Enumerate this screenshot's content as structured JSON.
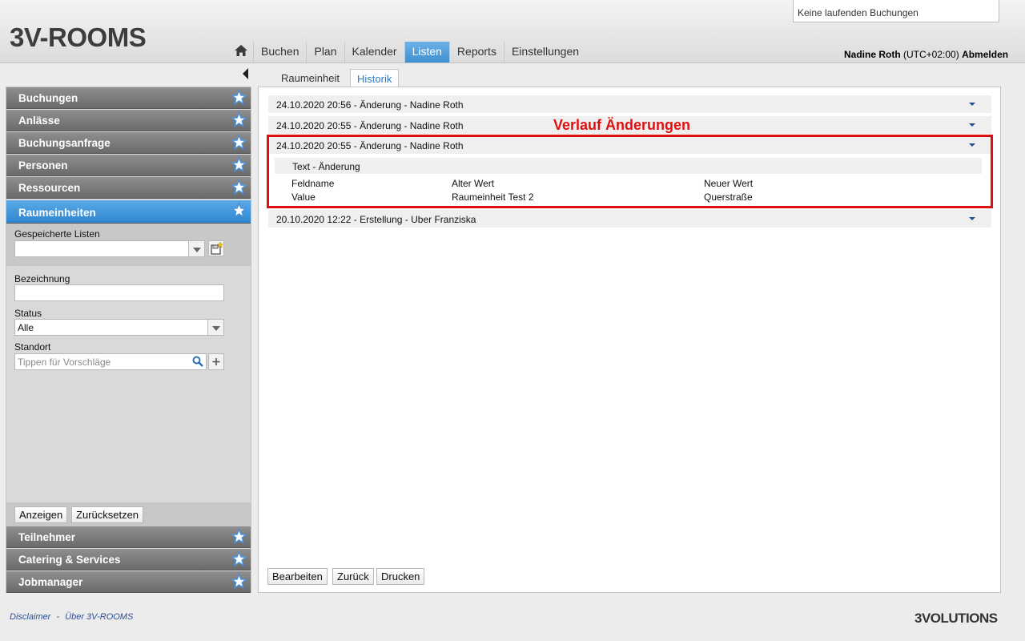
{
  "app": {
    "logo": "3V-ROOMS",
    "booking_status": "Keine laufenden Buchungen",
    "footer_logo": "3VOLUTIONS"
  },
  "nav": {
    "home_icon": "home-icon",
    "items": [
      "Buchen",
      "Plan",
      "Kalender",
      "Listen",
      "Reports",
      "Einstellungen"
    ],
    "active": "Listen"
  },
  "user": {
    "name": "Nadine Roth",
    "timezone": "(UTC+02:00)",
    "logout": "Abmelden"
  },
  "sidebar": {
    "sections_top": [
      "Buchungen",
      "Anlässe",
      "Buchungsanfrage",
      "Personen",
      "Ressourcen",
      "Raumeinheiten"
    ],
    "active_section": "Raumeinheiten",
    "sections_bottom": [
      "Teilnehmer",
      "Catering & Services",
      "Jobmanager"
    ],
    "saved_lists_label": "Gespeicherte Listen",
    "saved_lists_value": "",
    "filters": {
      "bezeichnung_label": "Bezeichnung",
      "bezeichnung_value": "",
      "status_label": "Status",
      "status_value": "Alle",
      "standort_label": "Standort",
      "standort_placeholder": "Tippen für Vorschläge"
    },
    "buttons": {
      "show": "Anzeigen",
      "reset": "Zurücksetzen"
    }
  },
  "tabs": [
    "Raumeinheit",
    "Historik"
  ],
  "active_tab": "Historik",
  "history": [
    {
      "label": "24.10.2020 20:56 - Änderung - Nadine Roth",
      "expanded": false
    },
    {
      "label": "24.10.2020 20:55 - Änderung - Nadine Roth",
      "expanded": false
    },
    {
      "label": "24.10.2020 20:55 - Änderung - Nadine Roth",
      "expanded": true
    },
    {
      "label": "20.10.2020 12:22 - Erstellung - Uber Franziska",
      "expanded": false
    }
  ],
  "detail": {
    "header": "Text - Änderung",
    "columns": [
      "Feldname",
      "Alter Wert",
      "Neuer Wert"
    ],
    "row": [
      "Value",
      "Raumeinheit Test 2",
      "Querstraße"
    ]
  },
  "annotation": "Verlauf Änderungen",
  "action_buttons": [
    "Bearbeiten",
    "Zurück",
    "Drucken"
  ],
  "footer": {
    "disclaimer": "Disclaimer",
    "separator": "-",
    "about": "Über 3V-ROOMS"
  },
  "colors": {
    "accent": "#3d8fd1",
    "annotation": "#e01010",
    "section_bg": "#7a7a7a"
  }
}
